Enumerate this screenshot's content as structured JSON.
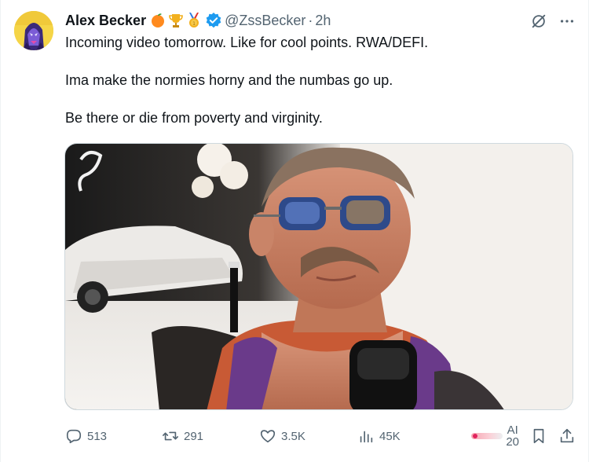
{
  "author": {
    "name": "Alex Becker",
    "badges": [
      "orange-emoji",
      "trophy-emoji",
      "medal-emoji"
    ],
    "verified": true,
    "handle": "@ZssBecker",
    "separator": "·",
    "time": "2h"
  },
  "tweet": {
    "lines": [
      "Incoming video tomorrow. Like for cool points. RWA/DEFI.",
      "",
      "Ima make the normies horny and the numbas go up.",
      "",
      "Be there or die from poverty and virginity."
    ]
  },
  "stats": {
    "replies": "513",
    "retweets": "291",
    "likes": "3.5K",
    "views": "45K",
    "ai_label": "AI",
    "ai_count": "20"
  },
  "icons": {
    "reply": "reply-icon",
    "retweet": "retweet-icon",
    "like": "heart-icon",
    "views": "views-icon",
    "bookmark": "bookmark-icon",
    "share": "share-icon",
    "grok": "grok-icon",
    "more": "more-icon"
  },
  "colors": {
    "verified": "#1d9bf0",
    "text": "#0f1419",
    "muted": "#536471"
  }
}
